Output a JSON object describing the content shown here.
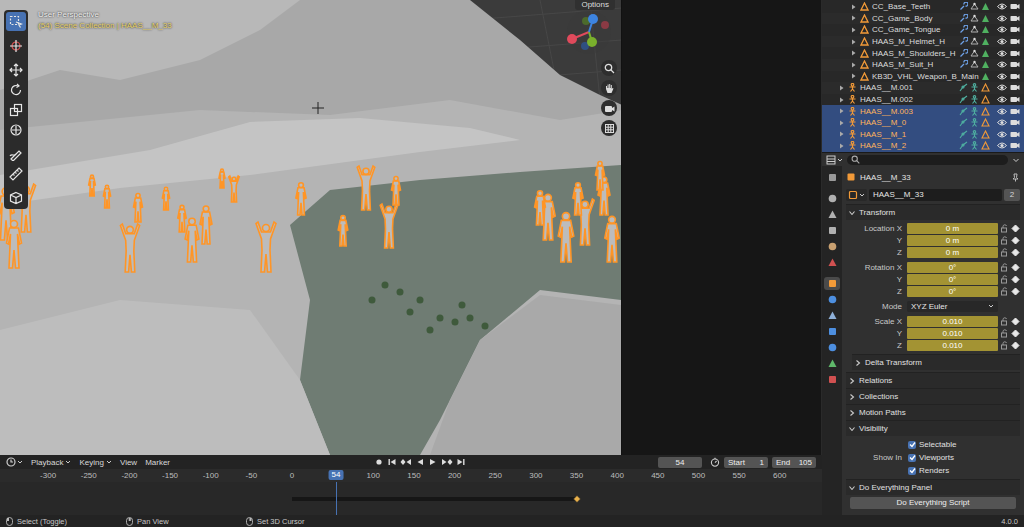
{
  "viewport": {
    "perspective": "User Perspective",
    "collection": "(54) Scene Collection | HAAS__M_33",
    "options": "Options",
    "objects_selected": true
  },
  "toolbar": [
    {
      "selected": true
    },
    {
      "selected": false
    },
    {
      "selected": false
    },
    {
      "selected": false
    },
    {
      "selected": false
    },
    {
      "selected": false
    },
    {
      "selected": false
    },
    {
      "selected": false
    },
    {
      "selected": false
    }
  ],
  "outliner": [
    {
      "name": "CC_Base_Teeth",
      "kind": "mesh",
      "selected": false
    },
    {
      "name": "CC_Game_Body",
      "kind": "mesh",
      "selected": false
    },
    {
      "name": "CC_Game_Tongue",
      "kind": "mesh",
      "selected": false
    },
    {
      "name": "HAAS_M_Helmet_H",
      "kind": "mesh",
      "selected": false
    },
    {
      "name": "HAAS_M_Shoulders_H",
      "kind": "mesh",
      "selected": false
    },
    {
      "name": "HAAS_M_Suit_H",
      "kind": "mesh",
      "selected": false
    },
    {
      "name": "KB3D_VHL_Weapon_B_Main",
      "kind": "mesh",
      "selected": false
    },
    {
      "name": "HAAS__M.001",
      "kind": "armature",
      "selected": false
    },
    {
      "name": "HAAS__M.002",
      "kind": "armature",
      "selected": false
    },
    {
      "name": "HAAS__M.003",
      "kind": "armature",
      "selected": true
    },
    {
      "name": "HAAS__M_0",
      "kind": "armature",
      "selected": true
    },
    {
      "name": "HAAS__M_1",
      "kind": "armature",
      "selected": true
    },
    {
      "name": "HAAS__M_2",
      "kind": "armature",
      "selected": true
    }
  ],
  "properties": {
    "tabs": [
      {
        "selected": false
      },
      {
        "selected": false
      },
      {
        "selected": false
      },
      {
        "selected": false
      },
      {
        "selected": false
      },
      {
        "selected": false
      },
      {
        "selected": true
      },
      {
        "selected": false
      },
      {
        "selected": false
      },
      {
        "selected": false
      },
      {
        "selected": false
      },
      {
        "selected": false
      },
      {
        "selected": false
      }
    ],
    "object": "HAAS__M_33",
    "datablock": {
      "name": "HAAS__M_33",
      "users": "2"
    },
    "transform": {
      "title": "Transform",
      "expanded": true,
      "location": [
        {
          "label": "Location X",
          "value": "0 m",
          "keyed": true
        },
        {
          "label": "Y",
          "value": "0 m",
          "keyed": true
        },
        {
          "label": "Z",
          "value": "0 m",
          "keyed": true
        }
      ],
      "rotation": [
        {
          "label": "Rotation X",
          "value": "0°",
          "keyed": true
        },
        {
          "label": "Y",
          "value": "0°",
          "keyed": true
        },
        {
          "label": "Z",
          "value": "0°",
          "keyed": true
        }
      ],
      "mode": {
        "label": "Mode",
        "value": "XYZ Euler"
      },
      "scale": [
        {
          "label": "Scale X",
          "value": "0.010",
          "keyed": true
        },
        {
          "label": "Y",
          "value": "0.010",
          "keyed": true
        },
        {
          "label": "Z",
          "value": "0.010",
          "keyed": true
        }
      ]
    },
    "delta": {
      "title": "Delta Transform",
      "expanded": false
    },
    "panels": [
      {
        "title": "Relations",
        "expanded": false
      },
      {
        "title": "Collections",
        "expanded": false
      },
      {
        "title": "Motion Paths",
        "expanded": false
      }
    ],
    "visibility": {
      "title": "Visibility",
      "expanded": true,
      "selectable": {
        "label": "Selectable",
        "checked": true
      },
      "show_in_label": "Show In",
      "show_in": [
        {
          "label": "Viewports",
          "checked": true
        },
        {
          "label": "Renders",
          "checked": true
        }
      ]
    },
    "custom": {
      "title": "Do Everything Panel",
      "expanded": true,
      "button": "Do Everything Script"
    }
  },
  "timeline": {
    "menus": [
      {
        "label": "Playback",
        "dropdown": true
      },
      {
        "label": "Keying",
        "dropdown": true
      },
      {
        "label": "View",
        "dropdown": false
      },
      {
        "label": "Marker",
        "dropdown": false
      }
    ],
    "current_frame": "54",
    "start": {
      "label": "Start",
      "value": "1"
    },
    "end": {
      "label": "End",
      "value": "105"
    },
    "ticks": [
      "-300",
      "-250",
      "-200",
      "-150",
      "-100",
      "-50",
      "0",
      "100",
      "150",
      "200",
      "250",
      "300",
      "350",
      "400",
      "450",
      "500",
      "550",
      "600"
    ],
    "keys": {
      "from": 0,
      "to": 350
    }
  },
  "status_bar": {
    "hints": [
      "Select (Toggle)",
      "Pan View",
      "Set 3D Cursor"
    ],
    "version": "4.0.0"
  }
}
